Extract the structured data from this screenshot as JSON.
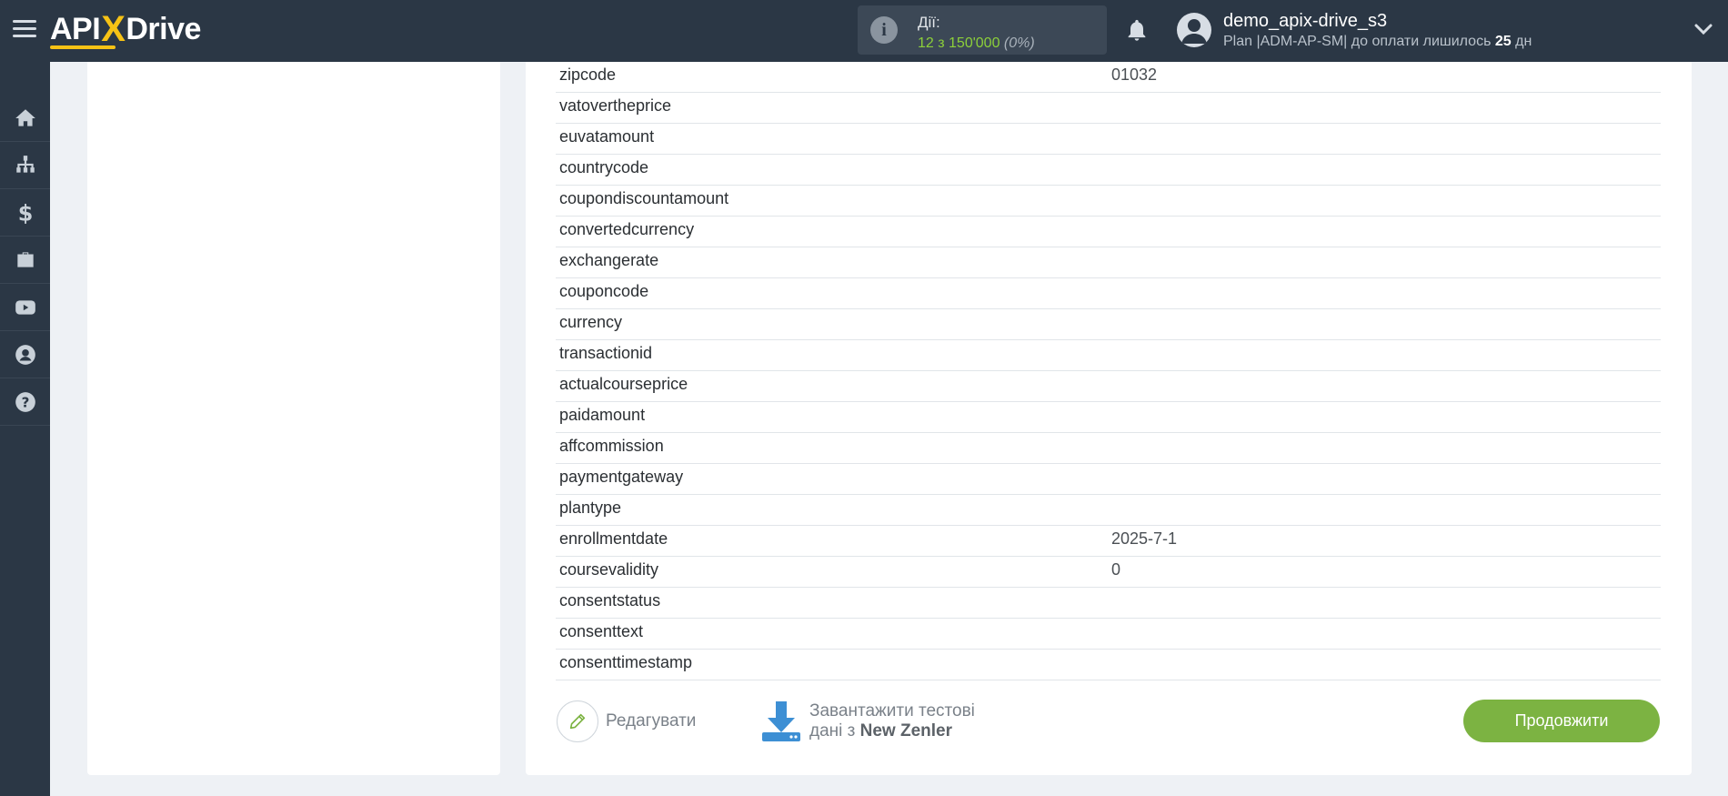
{
  "header": {
    "logo_left": "API",
    "logo_x": "X",
    "logo_right": "Drive",
    "actions_label": "Дії:",
    "actions_count": "12 з 150'000",
    "actions_pct": "(0%)",
    "username": "demo_apix-drive_s3",
    "plan_prefix": "Plan |ADM-AP-SM| до оплати лишилось",
    "plan_days": "25",
    "plan_suffix": "дн"
  },
  "sidebar": {
    "items": [
      {
        "icon": "home-icon"
      },
      {
        "icon": "sitemap-icon"
      },
      {
        "icon": "dollar-icon"
      },
      {
        "icon": "briefcase-icon"
      },
      {
        "icon": "youtube-icon"
      },
      {
        "icon": "user-circle-icon"
      },
      {
        "icon": "help-icon"
      }
    ]
  },
  "fields": [
    {
      "key": "zipcode",
      "value": "01032"
    },
    {
      "key": "vatovertheprice",
      "value": ""
    },
    {
      "key": "euvatamount",
      "value": ""
    },
    {
      "key": "countrycode",
      "value": ""
    },
    {
      "key": "coupondiscountamount",
      "value": ""
    },
    {
      "key": "convertedcurrency",
      "value": ""
    },
    {
      "key": "exchangerate",
      "value": ""
    },
    {
      "key": "couponcode",
      "value": ""
    },
    {
      "key": "currency",
      "value": ""
    },
    {
      "key": "transactionid",
      "value": ""
    },
    {
      "key": "actualcourseprice",
      "value": ""
    },
    {
      "key": "paidamount",
      "value": ""
    },
    {
      "key": "affcommission",
      "value": ""
    },
    {
      "key": "paymentgateway",
      "value": ""
    },
    {
      "key": "plantype",
      "value": ""
    },
    {
      "key": "enrollmentdate",
      "value": "2025-7-1"
    },
    {
      "key": "coursevalidity",
      "value": "0"
    },
    {
      "key": "consentstatus",
      "value": ""
    },
    {
      "key": "consenttext",
      "value": ""
    },
    {
      "key": "consenttimestamp",
      "value": ""
    }
  ],
  "footer": {
    "edit_label": "Редагувати",
    "download_line1": "Завантажити тестові",
    "download_line2_prefix": "дані з",
    "download_source": "New Zenler",
    "continue_label": "Продовжити"
  },
  "colors": {
    "topbar": "#2b3745",
    "accent_green": "#7cb342",
    "logo_yellow": "#f6c215",
    "download_blue": "#3d8fd4"
  }
}
